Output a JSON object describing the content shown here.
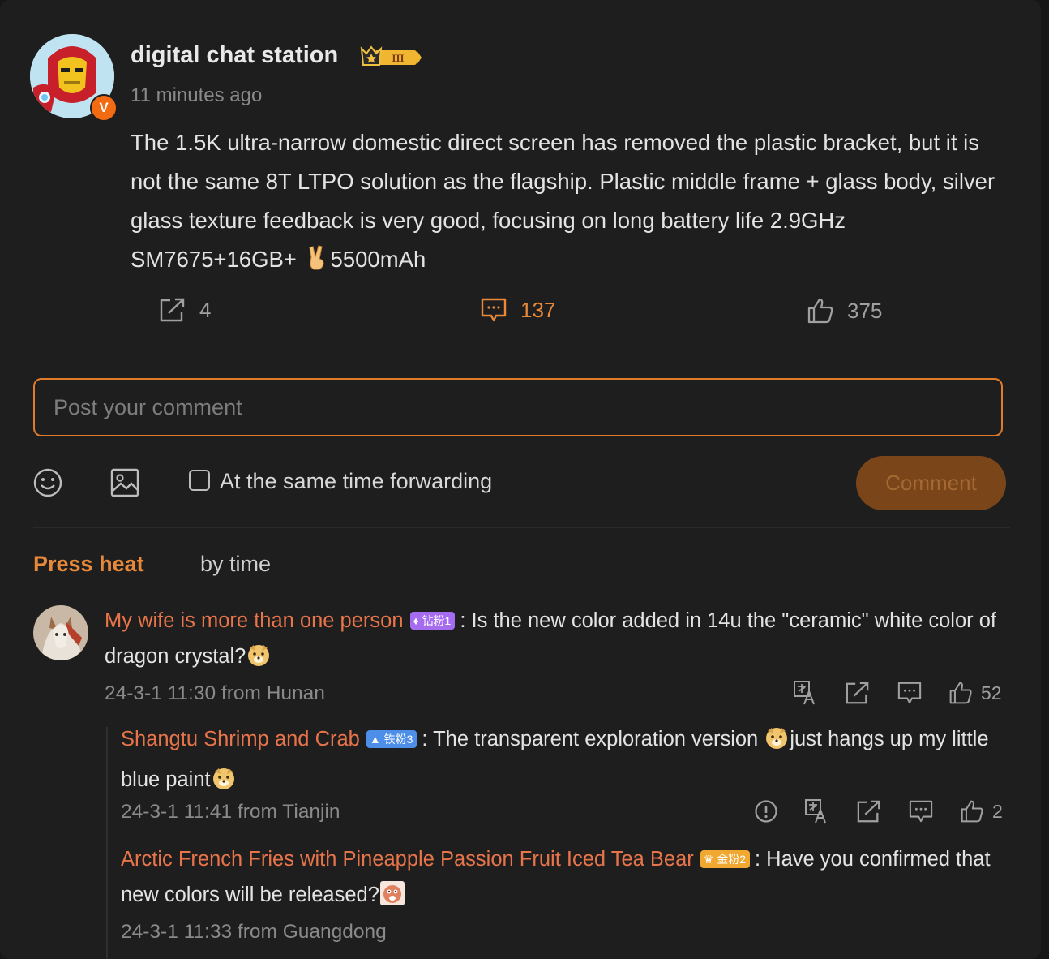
{
  "post": {
    "author": "digital chat station",
    "rank_badge_label": "III",
    "time": "11 minutes ago",
    "body_before_emoji": "The 1.5K ultra-narrow domestic direct screen has removed the plastic bracket, but it is not the same 8T LTPO solution as the flagship. Plastic middle frame + glass body, silver glass texture feedback is very good, focusing on long battery life 2.9GHz SM7675+16GB+",
    "body_after_emoji": "5500mAh",
    "verified_badge": "V",
    "stats": {
      "forwards": "4",
      "comments": "137",
      "likes": "375"
    }
  },
  "composer": {
    "placeholder": "Post your comment",
    "forward_label": "At the same time forwarding",
    "forward_checked": false,
    "submit_label": "Comment"
  },
  "sort": {
    "hot_label": "Press heat",
    "time_label": "by time",
    "active": "hot"
  },
  "comments": [
    {
      "user": "My wife is more than one person",
      "badge": "钻粉1",
      "text": ": Is the new color added in 14u the \"ceramic\" white color of dragon crystal?",
      "time": "24-3-1 11:30 from Hunan",
      "likes": "52",
      "replies": [
        {
          "user": "Shangtu Shrimp and Crab",
          "badge": "铁粉3",
          "text_before_emoji": ": The transparent exploration version ",
          "text_after_emoji": "just hangs up my little blue paint",
          "time": "24-3-1 11:41 from Tianjin",
          "likes": "2"
        },
        {
          "user": "Arctic French Fries with Pineapple Passion Fruit Iced Tea Bear",
          "badge": "金粉2",
          "text": ": Have you confirmed that new colors will be released?",
          "time": "24-3-1 11:33 from Guangdong"
        }
      ]
    }
  ],
  "colors": {
    "accent": "#e8893a",
    "username": "#e8744a",
    "background": "#1e1e1e"
  },
  "icons": [
    "forward-icon",
    "comment-icon",
    "like-icon",
    "emoji-icon",
    "image-icon",
    "translate-icon",
    "report-icon"
  ]
}
